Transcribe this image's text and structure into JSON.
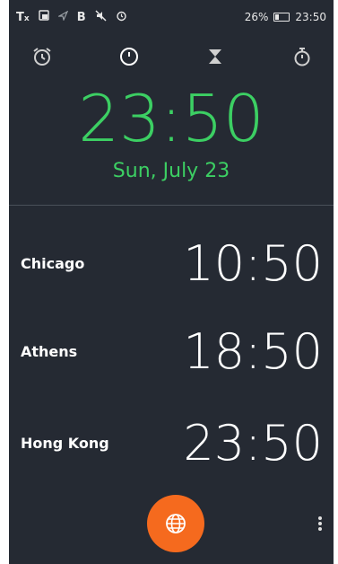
{
  "status_bar": {
    "left_icons": [
      "tx-icon",
      "photo-icon",
      "location-icon",
      "bluetooth-icon",
      "mute-icon",
      "alarm-icon"
    ],
    "bluetooth_letter": "B",
    "tx_label": "T",
    "battery_percent": "26%",
    "time": "23:50"
  },
  "tabs": [
    {
      "name": "alarm",
      "icon": "alarm-tab-icon"
    },
    {
      "name": "clock",
      "icon": "clock-tab-icon"
    },
    {
      "name": "timer",
      "icon": "hourglass-tab-icon"
    },
    {
      "name": "stopwatch",
      "icon": "stopwatch-tab-icon"
    }
  ],
  "main_clock": {
    "time": "23:50",
    "date": "Sun, July 23",
    "color": "#3ccf63"
  },
  "world_clocks": [
    {
      "city": "Chicago",
      "time": "10:50"
    },
    {
      "city": "Athens",
      "time": "18:50"
    },
    {
      "city": "Hong Kong",
      "time": "23:50"
    }
  ],
  "fab": {
    "icon": "globe-icon",
    "color": "#f56a1e"
  },
  "menu": {
    "icon": "more-vertical-icon"
  }
}
